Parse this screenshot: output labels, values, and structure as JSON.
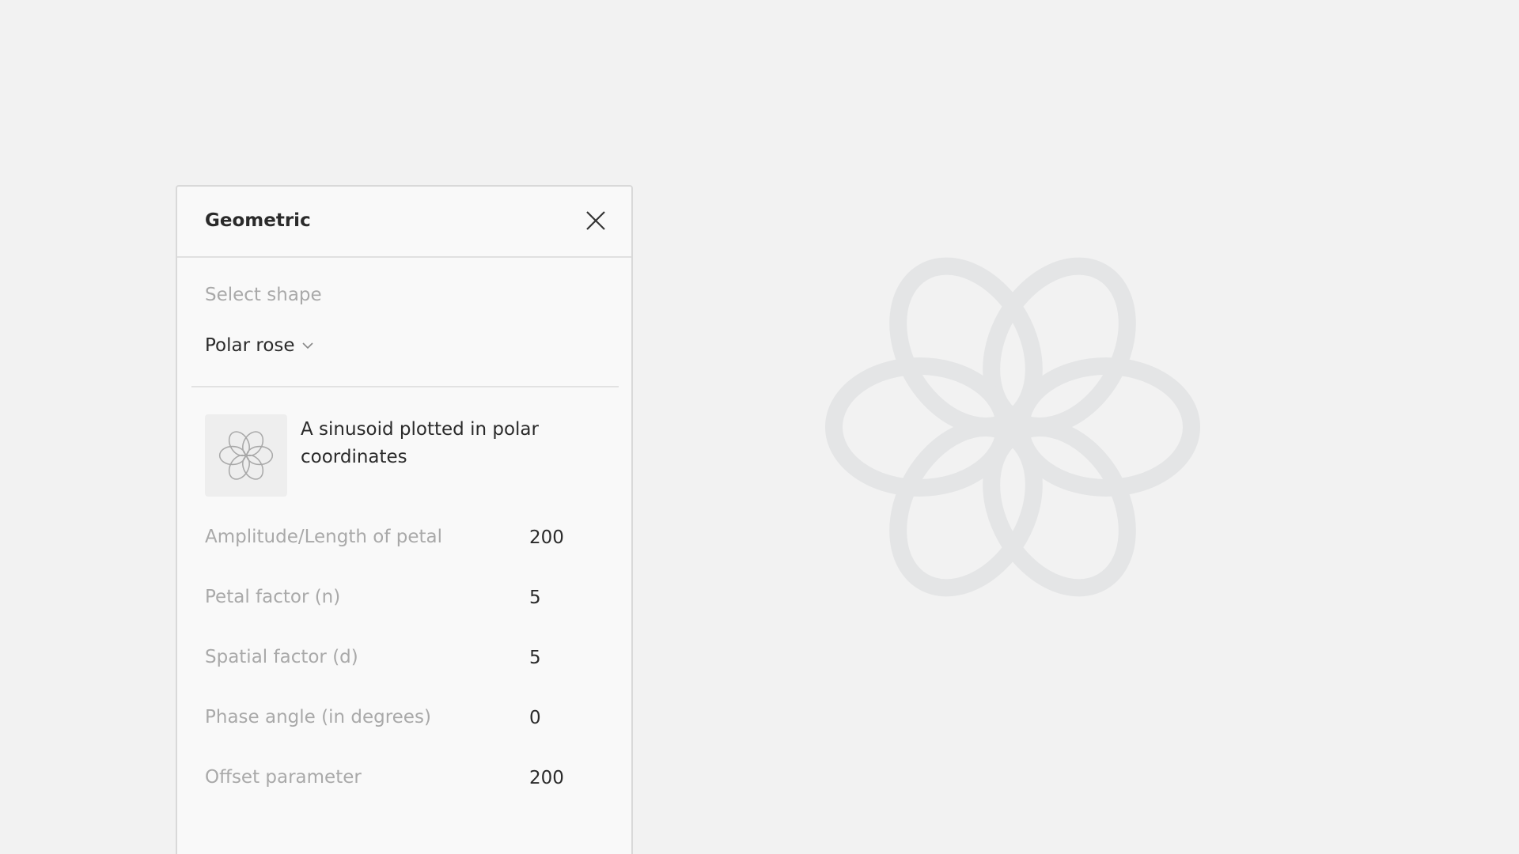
{
  "panel": {
    "title": "Geometric",
    "select_label": "Select shape",
    "selected_shape": "Polar rose",
    "description": "A sinusoid plotted in polar coordinates",
    "params": [
      {
        "label": "Amplitude/Length of petal",
        "value": "200"
      },
      {
        "label": "Petal factor (n)",
        "value": "5"
      },
      {
        "label": "Spatial factor (d)",
        "value": "5"
      },
      {
        "label": "Phase angle (in degrees)",
        "value": "0"
      },
      {
        "label": "Offset parameter",
        "value": "200"
      }
    ]
  },
  "icons": {
    "close": "close-icon",
    "dropdown": "chevron-down-icon",
    "thumbnail": "polar-rose-icon"
  },
  "colors": {
    "background": "#f2f2f2",
    "panel": "#f9f9f9",
    "rose_canvas": "#e4e5e6",
    "rose_thumb": "#a8a8a8"
  }
}
